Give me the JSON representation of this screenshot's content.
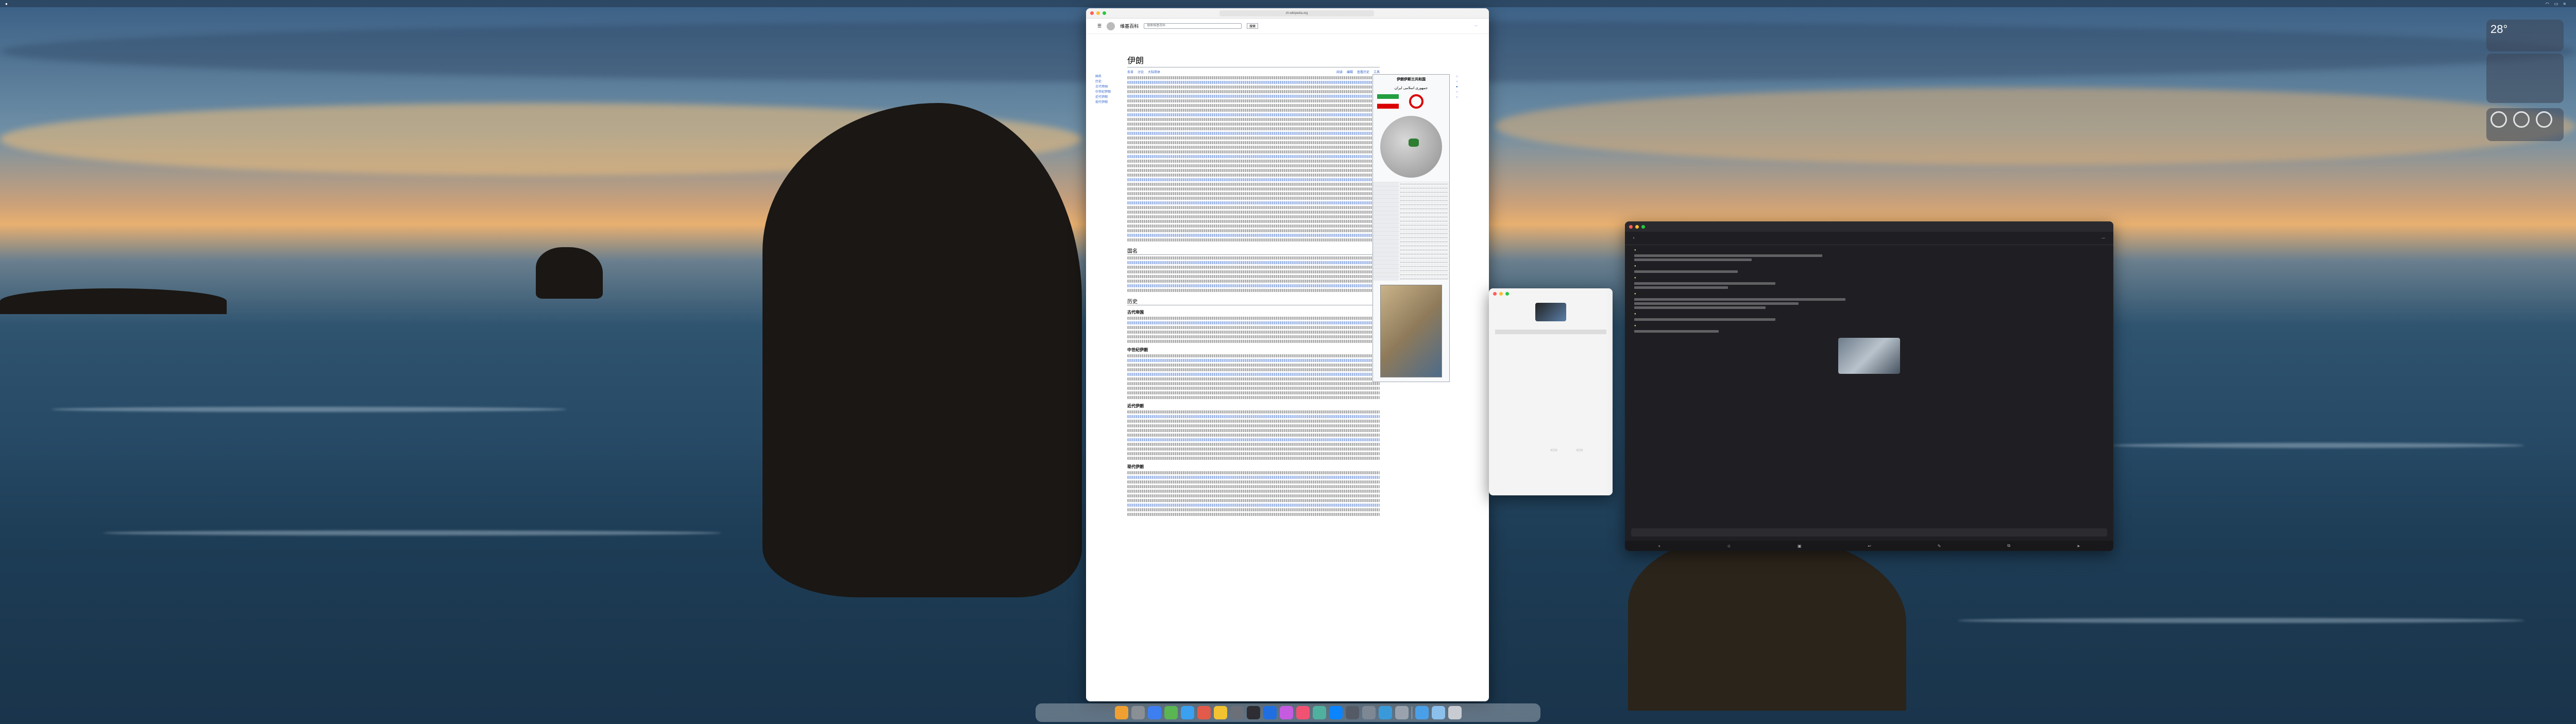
{
  "menubar": {
    "left_items": [
      "",
      "",
      "",
      "",
      ""
    ],
    "time": ""
  },
  "browser": {
    "url": "zh.wikipedia.org",
    "site_name": "维基百科",
    "search_placeholder": "搜索维基百科",
    "search_button": "搜索",
    "article_title": "伊朗",
    "tabs": [
      "条目",
      "讨论",
      "大陆简体",
      "阅读",
      "编辑",
      "查看历史",
      "工具"
    ],
    "sections": [
      "国名",
      "历史",
      "古代帝国",
      "中世纪伊朗",
      "近代伊朗",
      "现代伊朗"
    ],
    "infobox_title": "伊朗伊斯兰共和国",
    "infobox_subtitle": "جمهوری اسلامی ایران"
  },
  "dialog": {
    "title": "",
    "items": [
      "",
      "",
      "",
      "",
      "",
      "",
      "",
      "",
      "",
      "",
      ""
    ],
    "cancel_label": "",
    "ok_label": ""
  },
  "chat": {
    "title": "",
    "header": "",
    "messages": [
      "",
      "",
      "",
      "",
      "",
      "",
      ""
    ],
    "composer_placeholder": ""
  },
  "weather": {
    "temp": "28°",
    "location": ""
  },
  "colors": {
    "wiki_link": "#3366cc",
    "chat_bg": "#1f1f23",
    "flag_green": "#239f40",
    "flag_red": "#da0000"
  }
}
